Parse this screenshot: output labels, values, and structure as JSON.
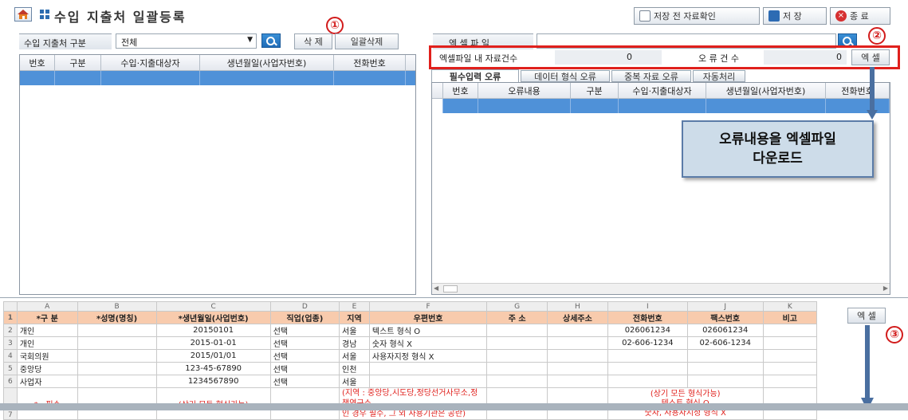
{
  "title": "수입 지출처 일괄등록",
  "toolbar": {
    "preview_label": "저장 전 자료확인",
    "save_label": "저 장",
    "close_label": "종 료"
  },
  "left": {
    "filter_label": "수입 지출처 구분",
    "filter_value": "전체",
    "delete_label": "삭 제",
    "delete_all_label": "일괄삭제",
    "columns": [
      "번호",
      "구분",
      "수입·지출대상자",
      "생년월일(사업자번호)",
      "전화번호"
    ]
  },
  "right": {
    "excel_file_label": "엑 셀 파 일",
    "excel_file_value": "",
    "count_label": "엑셀파일 내 자료건수",
    "count_value": "0",
    "error_label": "오 류 건 수",
    "error_value": "0",
    "excel_button": "엑 셀",
    "tabs": [
      "필수입력 오류",
      "데이터 형식 오류",
      "중복 자료 오류",
      "자동처리"
    ],
    "columns": [
      "번호",
      "오류내용",
      "구분",
      "수입·지출대상자",
      "생년월일(사업자번호)",
      "전화번호"
    ]
  },
  "callout": {
    "line1": "오류내용을 엑셀파일",
    "line2": "다운로드"
  },
  "markers": [
    "①",
    "②",
    "③"
  ],
  "sheet": {
    "col_letters": [
      "A",
      "B",
      "C",
      "D",
      "E",
      "F",
      "G",
      "H",
      "I",
      "J",
      "K"
    ],
    "headers": [
      "*구  분",
      "*성명(명칭)",
      "*생년월일(사업번호)",
      "직업(업종)",
      "지역",
      "우편번호",
      "주  소",
      "상세주소",
      "전화번호",
      "팩스번호",
      "비고"
    ],
    "rows": [
      {
        "n": "2",
        "a": "개인",
        "c": "20150101",
        "d": "선택",
        "e": "서울",
        "f": "텍스트 형식 O",
        "i": "026061234",
        "j": "026061234"
      },
      {
        "n": "3",
        "a": "개인",
        "c": "2015-01-01",
        "d": "선택",
        "e": "경남",
        "f": "숫자 형식 X",
        "i": "02-606-1234",
        "j": "02-606-1234"
      },
      {
        "n": "4",
        "a": "국회의원",
        "c": "2015/01/01",
        "d": "선택",
        "e": "서울",
        "f": "사용자지정 형식 X",
        "i": "",
        "j": ""
      },
      {
        "n": "5",
        "a": "중앙당",
        "c": "123-45-67890",
        "d": "선택",
        "e": "인천",
        "f": "",
        "i": "",
        "j": ""
      },
      {
        "n": "6",
        "a": "사업자",
        "c": "1234567890",
        "d": "선택",
        "e": "서울",
        "f": "",
        "i": "",
        "j": ""
      }
    ],
    "row7": {
      "n": "7",
      "a": "* : 필수",
      "c": "(상기 모든 형식가능)",
      "ef1": "(지역 : 중앙당,시도당,정당선거사무소,정책연구소",
      "ef2": "인 경우 필수, 그 외 사용기관은 공란)",
      "ij1": "(상기 모든 형식가능)",
      "ij2": "텍스트 형식 O",
      "ij3": "숫자, 사용자지정 형식 X"
    },
    "excel_button": "엑 셀"
  }
}
